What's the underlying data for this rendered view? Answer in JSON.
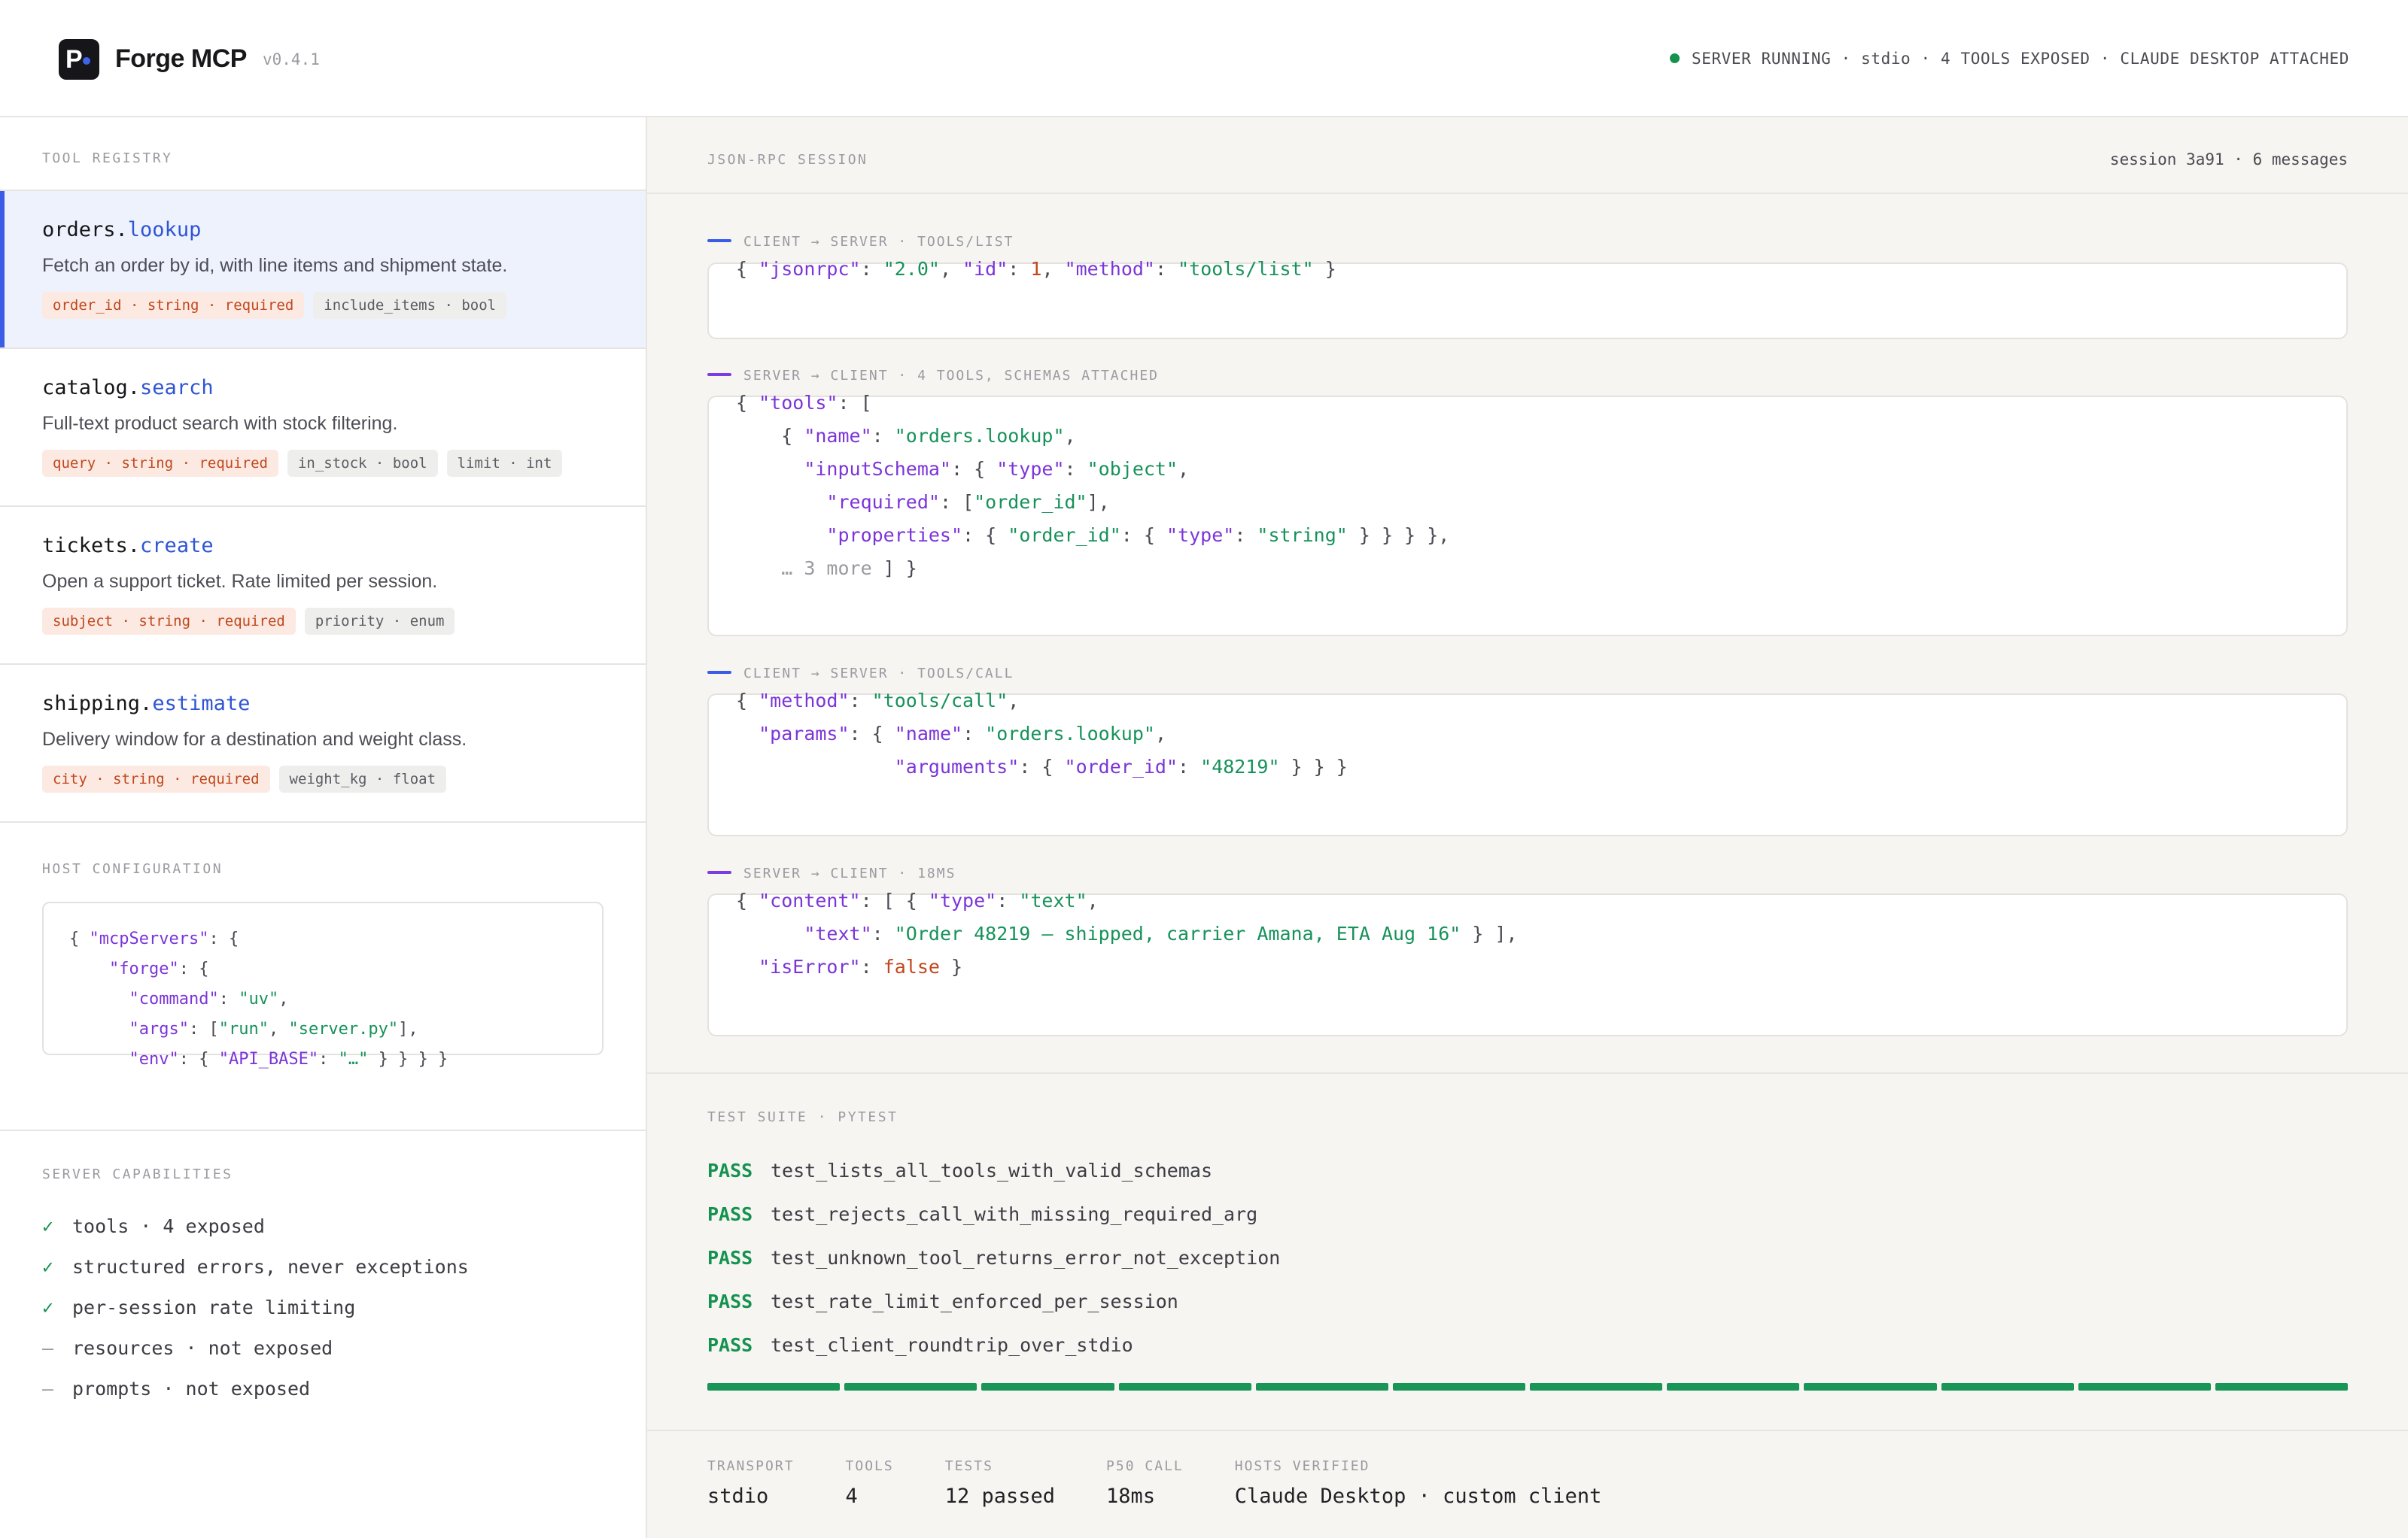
{
  "header": {
    "logo_glyph": "P",
    "app_name": "Forge MCP",
    "version": "v0.4.1",
    "status": "SERVER RUNNING · stdio · 4 TOOLS EXPOSED · CLAUDE DESKTOP ATTACHED",
    "status_color": "#15924f"
  },
  "registry": {
    "label": "TOOL REGISTRY",
    "tools": [
      {
        "ns": "orders.",
        "verb": "lookup",
        "desc": "Fetch an order by id, with line items and shipment state.",
        "params": [
          {
            "text": "order_id · string · required",
            "required": true
          },
          {
            "text": "include_items · bool",
            "required": false
          }
        ]
      },
      {
        "ns": "catalog.",
        "verb": "search",
        "desc": "Full-text product search with stock filtering.",
        "params": [
          {
            "text": "query · string · required",
            "required": true
          },
          {
            "text": "in_stock · bool",
            "required": false
          },
          {
            "text": "limit · int",
            "required": false
          }
        ]
      },
      {
        "ns": "tickets.",
        "verb": "create",
        "desc": "Open a support ticket. Rate limited per session.",
        "params": [
          {
            "text": "subject · string · required",
            "required": true
          },
          {
            "text": "priority · enum",
            "required": false
          }
        ]
      },
      {
        "ns": "shipping.",
        "verb": "estimate",
        "desc": "Delivery window for a destination and weight class.",
        "params": [
          {
            "text": "city · string · required",
            "required": true
          },
          {
            "text": "weight_kg · float",
            "required": false
          }
        ]
      }
    ]
  },
  "host": {
    "label": "HOST CONFIGURATION",
    "lines": [
      [
        {
          "t": "{ ",
          "c": ""
        },
        {
          "t": "\"mcpServers\"",
          "c": "k"
        },
        {
          "t": ": {",
          "c": ""
        }
      ],
      [
        {
          "t": "    ",
          "c": ""
        },
        {
          "t": "\"forge\"",
          "c": "k"
        },
        {
          "t": ": {",
          "c": ""
        }
      ],
      [
        {
          "t": "      ",
          "c": ""
        },
        {
          "t": "\"command\"",
          "c": "k"
        },
        {
          "t": ": ",
          "c": ""
        },
        {
          "t": "\"uv\"",
          "c": "s"
        },
        {
          "t": ",",
          "c": ""
        }
      ],
      [
        {
          "t": "      ",
          "c": ""
        },
        {
          "t": "\"args\"",
          "c": "k"
        },
        {
          "t": ": [",
          "c": ""
        },
        {
          "t": "\"run\"",
          "c": "s"
        },
        {
          "t": ", ",
          "c": ""
        },
        {
          "t": "\"server.py\"",
          "c": "s"
        },
        {
          "t": "],",
          "c": ""
        }
      ],
      [
        {
          "t": "      ",
          "c": ""
        },
        {
          "t": "\"env\"",
          "c": "k"
        },
        {
          "t": ": { ",
          "c": ""
        },
        {
          "t": "\"API_BASE\"",
          "c": "k"
        },
        {
          "t": ": ",
          "c": ""
        },
        {
          "t": "\"…\"",
          "c": "s"
        },
        {
          "t": " } } } }",
          "c": ""
        }
      ]
    ]
  },
  "capabilities": {
    "label": "SERVER CAPABILITIES",
    "items": [
      {
        "mark": "✓",
        "text": "tools · 4 exposed",
        "enabled": true
      },
      {
        "mark": "✓",
        "text": "structured errors, never exceptions",
        "enabled": true
      },
      {
        "mark": "✓",
        "text": "per-session rate limiting",
        "enabled": true
      },
      {
        "mark": "—",
        "text": "resources · not exposed",
        "enabled": false
      },
      {
        "mark": "—",
        "text": "prompts · not exposed",
        "enabled": false
      }
    ]
  },
  "session": {
    "label": "JSON-RPC SESSION",
    "info": "session 3a91 · 6 messages",
    "messages": [
      {
        "direction": "client",
        "head": "CLIENT → SERVER · TOOLS/LIST",
        "lines": [
          [
            {
              "t": "{ ",
              "c": ""
            },
            {
              "t": "\"jsonrpc\"",
              "c": "k"
            },
            {
              "t": ": ",
              "c": ""
            },
            {
              "t": "\"2.0\"",
              "c": "s"
            },
            {
              "t": ", ",
              "c": ""
            },
            {
              "t": "\"id\"",
              "c": "k"
            },
            {
              "t": ": ",
              "c": ""
            },
            {
              "t": "1",
              "c": "n"
            },
            {
              "t": ", ",
              "c": ""
            },
            {
              "t": "\"method\"",
              "c": "k"
            },
            {
              "t": ": ",
              "c": ""
            },
            {
              "t": "\"tools/list\"",
              "c": "s"
            },
            {
              "t": " }",
              "c": ""
            }
          ]
        ]
      },
      {
        "direction": "server",
        "head": "SERVER → CLIENT · 4 TOOLS, SCHEMAS ATTACHED",
        "lines": [
          [
            {
              "t": "{ ",
              "c": ""
            },
            {
              "t": "\"tools\"",
              "c": "k"
            },
            {
              "t": ": [",
              "c": ""
            }
          ],
          [
            {
              "t": "    { ",
              "c": ""
            },
            {
              "t": "\"name\"",
              "c": "k"
            },
            {
              "t": ": ",
              "c": ""
            },
            {
              "t": "\"orders.lookup\"",
              "c": "s"
            },
            {
              "t": ",",
              "c": ""
            }
          ],
          [
            {
              "t": "      ",
              "c": ""
            },
            {
              "t": "\"inputSchema\"",
              "c": "k"
            },
            {
              "t": ": { ",
              "c": ""
            },
            {
              "t": "\"type\"",
              "c": "k"
            },
            {
              "t": ": ",
              "c": ""
            },
            {
              "t": "\"object\"",
              "c": "s"
            },
            {
              "t": ",",
              "c": ""
            }
          ],
          [
            {
              "t": "        ",
              "c": ""
            },
            {
              "t": "\"required\"",
              "c": "k"
            },
            {
              "t": ": [",
              "c": ""
            },
            {
              "t": "\"order_id\"",
              "c": "s"
            },
            {
              "t": "],",
              "c": ""
            }
          ],
          [
            {
              "t": "        ",
              "c": ""
            },
            {
              "t": "\"properties\"",
              "c": "k"
            },
            {
              "t": ": { ",
              "c": ""
            },
            {
              "t": "\"order_id\"",
              "c": "s"
            },
            {
              "t": ": { ",
              "c": ""
            },
            {
              "t": "\"type\"",
              "c": "k"
            },
            {
              "t": ": ",
              "c": ""
            },
            {
              "t": "\"string\"",
              "c": "s"
            },
            {
              "t": " } } } },",
              "c": ""
            }
          ],
          [
            {
              "t": "    ",
              "c": ""
            },
            {
              "t": "… 3 more",
              "c": "c"
            },
            {
              "t": " ] }",
              "c": ""
            }
          ]
        ]
      },
      {
        "direction": "client",
        "head": "CLIENT → SERVER · TOOLS/CALL",
        "lines": [
          [
            {
              "t": "{ ",
              "c": ""
            },
            {
              "t": "\"method\"",
              "c": "k"
            },
            {
              "t": ": ",
              "c": ""
            },
            {
              "t": "\"tools/call\"",
              "c": "s"
            },
            {
              "t": ",",
              "c": ""
            }
          ],
          [
            {
              "t": "  ",
              "c": ""
            },
            {
              "t": "\"params\"",
              "c": "k"
            },
            {
              "t": ": { ",
              "c": ""
            },
            {
              "t": "\"name\"",
              "c": "k"
            },
            {
              "t": ": ",
              "c": ""
            },
            {
              "t": "\"orders.lookup\"",
              "c": "s"
            },
            {
              "t": ",",
              "c": ""
            }
          ],
          [
            {
              "t": "              ",
              "c": ""
            },
            {
              "t": "\"arguments\"",
              "c": "k"
            },
            {
              "t": ": { ",
              "c": ""
            },
            {
              "t": "\"order_id\"",
              "c": "k"
            },
            {
              "t": ": ",
              "c": ""
            },
            {
              "t": "\"48219\"",
              "c": "s"
            },
            {
              "t": " } } }",
              "c": ""
            }
          ]
        ]
      },
      {
        "direction": "server",
        "head": "SERVER → CLIENT · 18MS",
        "lines": [
          [
            {
              "t": "{ ",
              "c": ""
            },
            {
              "t": "\"content\"",
              "c": "k"
            },
            {
              "t": ": [ { ",
              "c": ""
            },
            {
              "t": "\"type\"",
              "c": "k"
            },
            {
              "t": ": ",
              "c": ""
            },
            {
              "t": "\"text\"",
              "c": "s"
            },
            {
              "t": ",",
              "c": ""
            }
          ],
          [
            {
              "t": "      ",
              "c": ""
            },
            {
              "t": "\"text\"",
              "c": "k"
            },
            {
              "t": ": ",
              "c": ""
            },
            {
              "t": "\"Order 48219 — shipped, carrier Amana, ETA Aug 16\"",
              "c": "s"
            },
            {
              "t": " } ],",
              "c": ""
            }
          ],
          [
            {
              "t": "  ",
              "c": ""
            },
            {
              "t": "\"isError\"",
              "c": "k"
            },
            {
              "t": ": ",
              "c": ""
            },
            {
              "t": "false",
              "c": "n"
            },
            {
              "t": " }",
              "c": ""
            }
          ]
        ]
      }
    ]
  },
  "suite": {
    "label": "TEST SUITE · PYTEST",
    "tests": [
      {
        "status": "PASS",
        "name": "test_lists_all_tools_with_valid_schemas"
      },
      {
        "status": "PASS",
        "name": "test_rejects_call_with_missing_required_arg"
      },
      {
        "status": "PASS",
        "name": "test_unknown_tool_returns_error_not_exception"
      },
      {
        "status": "PASS",
        "name": "test_rate_limit_enforced_per_session"
      },
      {
        "status": "PASS",
        "name": "test_client_roundtrip_over_stdio"
      }
    ],
    "progress_passed": 12,
    "progress_total": 12,
    "progress_color": "#1a9558"
  },
  "stats": [
    {
      "label": "TRANSPORT",
      "value": "stdio"
    },
    {
      "label": "TOOLS",
      "value": "4"
    },
    {
      "label": "TESTS",
      "value": "12 passed"
    },
    {
      "label": "P50 CALL",
      "value": "18ms"
    },
    {
      "label": "HOSTS VERIFIED",
      "value": "Claude Desktop · custom client"
    }
  ]
}
